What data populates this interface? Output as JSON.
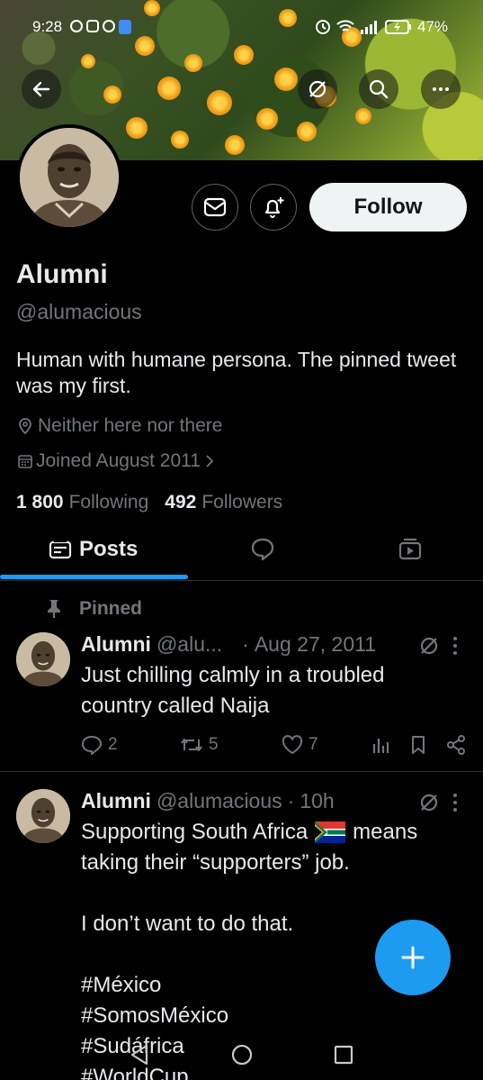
{
  "status_bar": {
    "time": "9:28",
    "battery": "47%"
  },
  "profile": {
    "name": "Alumni",
    "handle": "@alumacious",
    "bio": "Human with humane persona. The pinned tweet was my first.",
    "location": "Neither here nor there",
    "joined": "Joined August 2011",
    "following_count": "1 800",
    "following_label": "Following",
    "followers_count": "492",
    "followers_label": "Followers"
  },
  "buttons": {
    "follow": "Follow"
  },
  "tabs": {
    "posts": "Posts"
  },
  "pinned_label": "Pinned",
  "tweets": [
    {
      "name": "Alumni",
      "handle": "@alu...",
      "sep": "·",
      "time": "Aug 27, 2011",
      "line1": "Just chilling calmly in a troubled",
      "line2": "country called Naija",
      "replies": "2",
      "retweets": "5",
      "likes": "7"
    },
    {
      "name": "Alumni",
      "handle": "@alumacious",
      "sep": "·",
      "time": "10h",
      "line1a": "Supporting South Africa",
      "line1b": "means",
      "line2": "taking their “supporters” job.",
      "line3": "I don’t want to do that.",
      "hashtags": [
        "#México",
        "#SomosMéxico",
        "#Sudáfrica",
        "#WorldCup"
      ]
    }
  ],
  "colors": {
    "accent": "#1d9bf0",
    "muted": "#71767b",
    "background": "#000000"
  }
}
